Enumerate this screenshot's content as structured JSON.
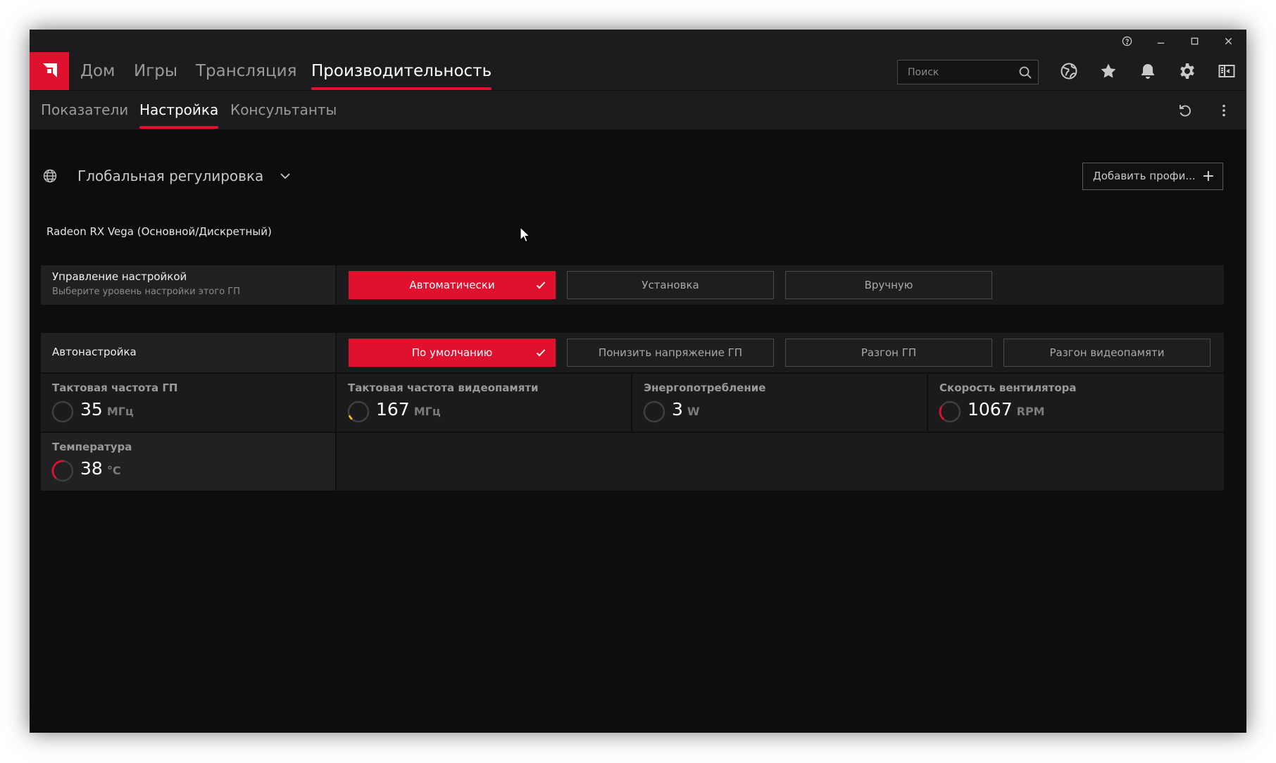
{
  "colors": {
    "accent": "#e0102f",
    "background": "#0d0d0e",
    "bar": "#1c1c1e",
    "panel": "#1b1b1d"
  },
  "window_controls": {
    "help_icon": "help-icon",
    "minimize_icon": "minimize-icon",
    "maximize_icon": "maximize-icon",
    "close_icon": "close-icon"
  },
  "nav": {
    "logo_icon": "amd-logo",
    "tabs": [
      "Дом",
      "Игры",
      "Трансляция",
      "Производительность"
    ],
    "active_tab": "Производительность",
    "search_placeholder": "Поиск",
    "icons": [
      "globe-icon",
      "star-icon",
      "bell-icon",
      "gear-icon",
      "sidebar-icon"
    ]
  },
  "subnav": {
    "tabs": [
      "Показатели",
      "Настройка",
      "Консультанты"
    ],
    "active_tab": "Настройка",
    "icons": [
      "reset-icon",
      "more-vertical-icon"
    ]
  },
  "profile": {
    "selected": "Глобальная регулировка",
    "add_button": "Добавить профи...",
    "add_icon": "+"
  },
  "gpu_name": "Radeon RX Vega (Основной/Дискретный)",
  "tuning_control": {
    "title": "Управление настройкой",
    "subtitle": "Выберите уровень настройки этого ГП",
    "options": [
      "Автоматически",
      "Установка",
      "Вручную"
    ],
    "selected": "Автоматически"
  },
  "auto_tuning": {
    "title": "Автонастройка",
    "options": [
      "По умолчанию",
      "Понизить напряжение ГП",
      "Разгон ГП",
      "Разгон видеопамяти"
    ],
    "selected": "По умолчанию"
  },
  "metrics": [
    {
      "label": "Тактовая частота ГП",
      "value": "35",
      "unit": "МГц",
      "gauge_fraction": 0.0,
      "gauge_color": "#4a4a4c"
    },
    {
      "label": "Тактовая частота видеопамяти",
      "value": "167",
      "unit": "МГц",
      "gauge_fraction": 0.05,
      "gauge_color": "#f2c200"
    },
    {
      "label": "Энергопотребление",
      "value": "3",
      "unit": "W",
      "gauge_fraction": 0.0,
      "gauge_color": "#4a4a4c"
    },
    {
      "label": "Скорость вентилятора",
      "value": "1067",
      "unit": "RPM",
      "gauge_fraction": 0.2,
      "gauge_color": "#e0102f"
    },
    {
      "label": "Температура",
      "value": "38",
      "unit": "°C",
      "gauge_fraction": 0.38,
      "gauge_color": "#e0102f"
    }
  ]
}
